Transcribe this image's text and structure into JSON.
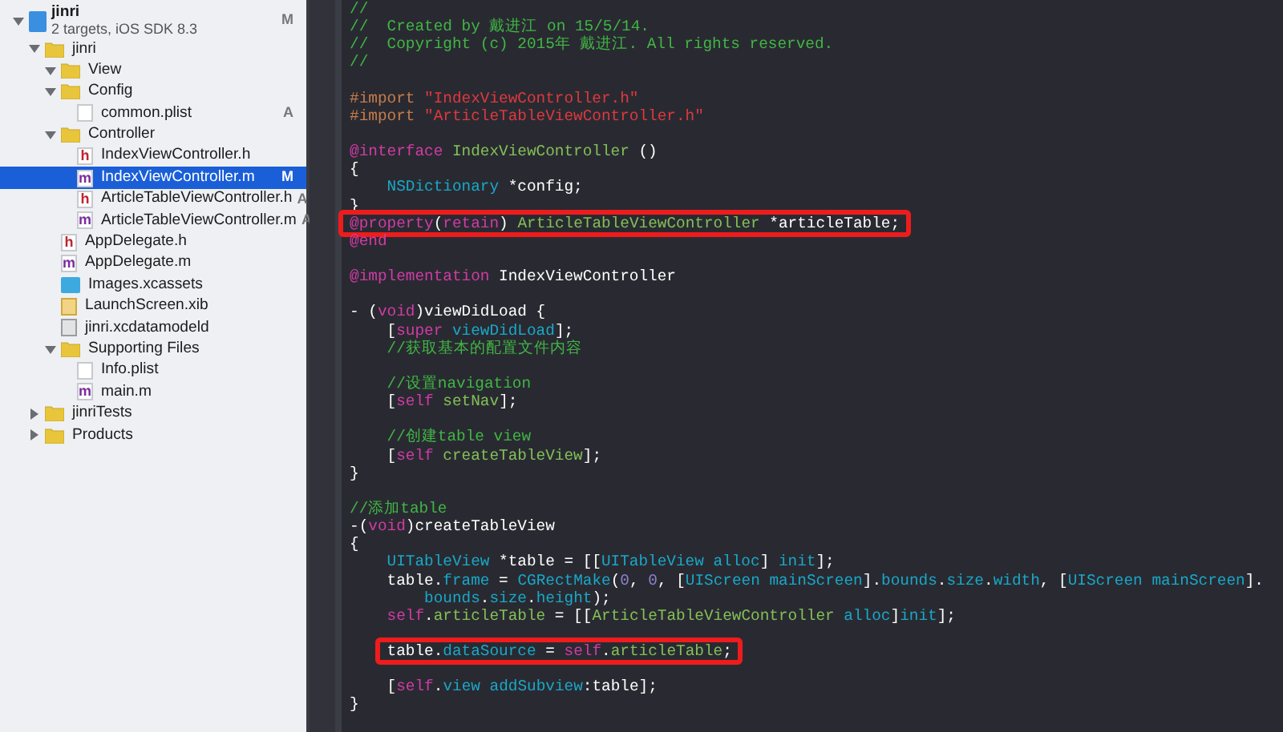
{
  "navigator": {
    "project": {
      "name": "jinri",
      "subtitle": "2 targets, iOS SDK 8.3",
      "badge": "M",
      "expanded": true,
      "selected": false
    },
    "items": [
      {
        "name": "jinri",
        "kind": "folder",
        "expanded": true,
        "selected": false,
        "children": [
          {
            "name": "View",
            "kind": "folder",
            "expanded": true,
            "selected": false
          },
          {
            "name": "Config",
            "kind": "folder",
            "expanded": true,
            "selected": false,
            "children": [
              {
                "name": "common.plist",
                "kind": "plist",
                "badge": "A",
                "selected": false
              }
            ]
          },
          {
            "name": "Controller",
            "kind": "folder",
            "expanded": true,
            "selected": false,
            "children": [
              {
                "name": "IndexViewController.h",
                "kind": "source",
                "icon_letter": "h",
                "selected": false
              },
              {
                "name": "IndexViewController.m",
                "kind": "source",
                "icon_letter": "m",
                "badge": "M",
                "selected": true
              },
              {
                "name": "ArticleTableViewController.h",
                "kind": "source",
                "icon_letter": "h",
                "badge": "A",
                "selected": false
              },
              {
                "name": "ArticleTableViewController.m",
                "kind": "source",
                "icon_letter": "m",
                "badge": "A",
                "selected": false
              }
            ]
          },
          {
            "name": "AppDelegate.h",
            "kind": "source",
            "icon_letter": "h",
            "selected": false
          },
          {
            "name": "AppDelegate.m",
            "kind": "source",
            "icon_letter": "m",
            "selected": false
          },
          {
            "name": "Images.xcassets",
            "kind": "xcassets",
            "selected": false
          },
          {
            "name": "LaunchScreen.xib",
            "kind": "xib",
            "selected": false
          },
          {
            "name": "jinri.xcdatamodeld",
            "kind": "datamodel",
            "selected": false
          },
          {
            "name": "Supporting Files",
            "kind": "folder",
            "expanded": true,
            "selected": false,
            "children": [
              {
                "name": "Info.plist",
                "kind": "plist",
                "selected": false
              },
              {
                "name": "main.m",
                "kind": "source",
                "icon_letter": "m",
                "selected": false
              }
            ]
          }
        ]
      },
      {
        "name": "jinriTests",
        "kind": "folder",
        "expanded": false,
        "selected": false
      },
      {
        "name": "Products",
        "kind": "folder",
        "expanded": false,
        "selected": false
      }
    ]
  },
  "editor": {
    "lines": [
      {
        "kind": "code",
        "highlighted": false,
        "tokens": [
          {
            "kind": "comment",
            "text": "//"
          }
        ]
      },
      {
        "kind": "code",
        "highlighted": false,
        "tokens": [
          {
            "kind": "comment",
            "text": "//  Created by 戴进江 on 15/5/14."
          }
        ]
      },
      {
        "kind": "code",
        "highlighted": false,
        "tokens": [
          {
            "kind": "comment",
            "text": "//  Copyright (c) 2015年 戴进江. All rights reserved."
          }
        ]
      },
      {
        "kind": "code",
        "highlighted": false,
        "tokens": [
          {
            "kind": "comment",
            "text": "//"
          }
        ]
      },
      {
        "kind": "blank"
      },
      {
        "kind": "code",
        "highlighted": false,
        "tokens": [
          {
            "kind": "preprocessor",
            "text": "#import "
          },
          {
            "kind": "string",
            "text": "\"IndexViewController.h\""
          }
        ]
      },
      {
        "kind": "code",
        "highlighted": false,
        "tokens": [
          {
            "kind": "preprocessor",
            "text": "#import "
          },
          {
            "kind": "string",
            "text": "\"ArticleTableViewController.h\""
          }
        ]
      },
      {
        "kind": "blank"
      },
      {
        "kind": "code",
        "highlighted": false,
        "tokens": [
          {
            "kind": "keyword",
            "text": "@interface"
          },
          {
            "kind": "project_class",
            "text": " IndexViewController"
          },
          {
            "kind": "plain",
            "text": " ()"
          }
        ]
      },
      {
        "kind": "code",
        "highlighted": false,
        "tokens": [
          {
            "kind": "plain",
            "text": "{"
          }
        ]
      },
      {
        "kind": "code",
        "highlighted": false,
        "tokens": [
          {
            "kind": "system",
            "text": "    NSDictionary"
          },
          {
            "kind": "plain",
            "text": " *config;"
          }
        ]
      },
      {
        "kind": "code",
        "highlighted": false,
        "tokens": [
          {
            "kind": "plain",
            "text": "}"
          }
        ]
      },
      {
        "kind": "code",
        "highlighted": true,
        "tokens": [
          {
            "kind": "keyword",
            "text": "@property"
          },
          {
            "kind": "plain",
            "text": "("
          },
          {
            "kind": "keyword",
            "text": "retain"
          },
          {
            "kind": "plain",
            "text": ") "
          },
          {
            "kind": "project_class",
            "text": "ArticleTableViewController"
          },
          {
            "kind": "plain",
            "text": " *articleTable;"
          }
        ]
      },
      {
        "kind": "code",
        "highlighted": false,
        "tokens": [
          {
            "kind": "keyword",
            "text": "@end"
          }
        ]
      },
      {
        "kind": "blank"
      },
      {
        "kind": "code",
        "highlighted": false,
        "tokens": [
          {
            "kind": "keyword",
            "text": "@implementation"
          },
          {
            "kind": "plain",
            "text": " IndexViewController"
          }
        ]
      },
      {
        "kind": "blank"
      },
      {
        "kind": "code",
        "highlighted": false,
        "tokens": [
          {
            "kind": "plain",
            "text": "- ("
          },
          {
            "kind": "keyword",
            "text": "void"
          },
          {
            "kind": "plain",
            "text": ")viewDidLoad {"
          }
        ]
      },
      {
        "kind": "code",
        "highlighted": false,
        "tokens": [
          {
            "kind": "plain",
            "text": "    ["
          },
          {
            "kind": "keyword",
            "text": "super"
          },
          {
            "kind": "system",
            "text": " viewDidLoad"
          },
          {
            "kind": "plain",
            "text": "];"
          }
        ]
      },
      {
        "kind": "code",
        "highlighted": false,
        "tokens": [
          {
            "kind": "comment",
            "text": "    //获取基本的配置文件内容"
          }
        ]
      },
      {
        "kind": "blank"
      },
      {
        "kind": "code",
        "highlighted": false,
        "tokens": [
          {
            "kind": "comment",
            "text": "    //设置navigation"
          }
        ]
      },
      {
        "kind": "code",
        "highlighted": false,
        "tokens": [
          {
            "kind": "plain",
            "text": "    ["
          },
          {
            "kind": "keyword",
            "text": "self"
          },
          {
            "kind": "project_member",
            "text": " setNav"
          },
          {
            "kind": "plain",
            "text": "];"
          }
        ]
      },
      {
        "kind": "blank"
      },
      {
        "kind": "code",
        "highlighted": false,
        "tokens": [
          {
            "kind": "comment",
            "text": "    //创建table view"
          }
        ]
      },
      {
        "kind": "code",
        "highlighted": false,
        "tokens": [
          {
            "kind": "plain",
            "text": "    ["
          },
          {
            "kind": "keyword",
            "text": "self"
          },
          {
            "kind": "project_member",
            "text": " createTableView"
          },
          {
            "kind": "plain",
            "text": "];"
          }
        ]
      },
      {
        "kind": "code",
        "highlighted": false,
        "tokens": [
          {
            "kind": "plain",
            "text": "}"
          }
        ]
      },
      {
        "kind": "blank"
      },
      {
        "kind": "code",
        "highlighted": false,
        "tokens": [
          {
            "kind": "comment",
            "text": "//添加table"
          }
        ]
      },
      {
        "kind": "code",
        "highlighted": false,
        "tokens": [
          {
            "kind": "plain",
            "text": "-("
          },
          {
            "kind": "keyword",
            "text": "void"
          },
          {
            "kind": "plain",
            "text": ")createTableView"
          }
        ]
      },
      {
        "kind": "code",
        "highlighted": false,
        "tokens": [
          {
            "kind": "plain",
            "text": "{"
          }
        ]
      },
      {
        "kind": "code",
        "highlighted": false,
        "tokens": [
          {
            "kind": "system",
            "text": "    UITableView"
          },
          {
            "kind": "plain",
            "text": " *table = [["
          },
          {
            "kind": "system",
            "text": "UITableView"
          },
          {
            "kind": "system",
            "text": " alloc"
          },
          {
            "kind": "plain",
            "text": "] "
          },
          {
            "kind": "system",
            "text": "init"
          },
          {
            "kind": "plain",
            "text": "];"
          }
        ]
      },
      {
        "kind": "code",
        "highlighted": false,
        "tokens": [
          {
            "kind": "plain",
            "text": "    table."
          },
          {
            "kind": "system",
            "text": "frame"
          },
          {
            "kind": "plain",
            "text": " = "
          },
          {
            "kind": "system",
            "text": "CGRectMake"
          },
          {
            "kind": "plain",
            "text": "("
          },
          {
            "kind": "number",
            "text": "0"
          },
          {
            "kind": "plain",
            "text": ", "
          },
          {
            "kind": "number",
            "text": "0"
          },
          {
            "kind": "plain",
            "text": ", ["
          },
          {
            "kind": "system",
            "text": "UIScreen"
          },
          {
            "kind": "system",
            "text": " mainScreen"
          },
          {
            "kind": "plain",
            "text": "]."
          },
          {
            "kind": "system",
            "text": "bounds"
          },
          {
            "kind": "plain",
            "text": "."
          },
          {
            "kind": "system",
            "text": "size"
          },
          {
            "kind": "plain",
            "text": "."
          },
          {
            "kind": "system",
            "text": "width"
          },
          {
            "kind": "plain",
            "text": ", ["
          },
          {
            "kind": "system",
            "text": "UIScreen"
          },
          {
            "kind": "system",
            "text": " mainScreen"
          },
          {
            "kind": "plain",
            "text": "]."
          }
        ]
      },
      {
        "kind": "code",
        "highlighted": false,
        "tokens": [
          {
            "kind": "system",
            "text": "        bounds"
          },
          {
            "kind": "plain",
            "text": "."
          },
          {
            "kind": "system",
            "text": "size"
          },
          {
            "kind": "plain",
            "text": "."
          },
          {
            "kind": "system",
            "text": "height"
          },
          {
            "kind": "plain",
            "text": ");"
          }
        ]
      },
      {
        "kind": "code",
        "highlighted": false,
        "tokens": [
          {
            "kind": "keyword",
            "text": "    self"
          },
          {
            "kind": "plain",
            "text": "."
          },
          {
            "kind": "project_member",
            "text": "articleTable"
          },
          {
            "kind": "plain",
            "text": " = [["
          },
          {
            "kind": "project_class",
            "text": "ArticleTableViewController"
          },
          {
            "kind": "system",
            "text": " alloc"
          },
          {
            "kind": "plain",
            "text": "]"
          },
          {
            "kind": "system",
            "text": "init"
          },
          {
            "kind": "plain",
            "text": "];"
          }
        ]
      },
      {
        "kind": "blank"
      },
      {
        "kind": "code",
        "highlighted": true,
        "tokens": [
          {
            "kind": "plain",
            "text": "    table."
          },
          {
            "kind": "system",
            "text": "dataSource"
          },
          {
            "kind": "plain",
            "text": " = "
          },
          {
            "kind": "keyword",
            "text": "self"
          },
          {
            "kind": "plain",
            "text": "."
          },
          {
            "kind": "project_member",
            "text": "articleTable"
          },
          {
            "kind": "plain",
            "text": ";"
          }
        ]
      },
      {
        "kind": "blank"
      },
      {
        "kind": "code",
        "highlighted": false,
        "tokens": [
          {
            "kind": "plain",
            "text": "    ["
          },
          {
            "kind": "keyword",
            "text": "self"
          },
          {
            "kind": "plain",
            "text": "."
          },
          {
            "kind": "system",
            "text": "view"
          },
          {
            "kind": "system",
            "text": " addSubview"
          },
          {
            "kind": "plain",
            "text": ":table];"
          }
        ]
      },
      {
        "kind": "code",
        "highlighted": false,
        "tokens": [
          {
            "kind": "plain",
            "text": "}"
          }
        ]
      }
    ]
  }
}
